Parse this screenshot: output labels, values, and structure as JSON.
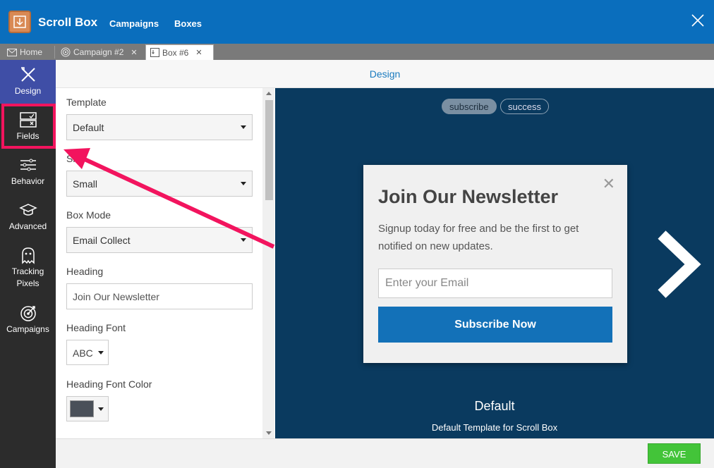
{
  "app": {
    "brand": "Scroll Box",
    "nav": [
      "Campaigns",
      "Boxes"
    ]
  },
  "tabs": [
    {
      "label": "Home",
      "closable": false
    },
    {
      "label": "Campaign #2",
      "closable": true
    },
    {
      "label": "Box #6",
      "closable": true
    }
  ],
  "sidebar": {
    "items": [
      {
        "label": "Design"
      },
      {
        "label": "Fields"
      },
      {
        "label": "Behavior"
      },
      {
        "label": "Advanced"
      },
      {
        "label": "Tracking Pixels"
      },
      {
        "label": "Campaigns"
      }
    ]
  },
  "panel": {
    "title": "Design"
  },
  "form": {
    "template_label": "Template",
    "template_value": "Default",
    "size_label": "Size",
    "size_value": "Small",
    "box_mode_label": "Box Mode",
    "box_mode_value": "Email Collect",
    "heading_label": "Heading",
    "heading_value": "Join Our Newsletter",
    "heading_font_label": "Heading Font",
    "heading_font_value": "ABC",
    "heading_font_color_label": "Heading Font Color",
    "heading_font_color": "#4a5059"
  },
  "preview": {
    "pills": [
      "subscribe",
      "success"
    ],
    "modal": {
      "heading": "Join Our Newsletter",
      "text": "Signup today for free and be the first to get notified on new updates.",
      "email_placeholder": "Enter your Email",
      "button": "Subscribe Now"
    },
    "template_name": "Default",
    "template_desc": "Default Template for Scroll Box"
  },
  "footer": {
    "save": "SAVE"
  },
  "colors": {
    "topbar": "#0a6ebd",
    "highlight": "#f2145e",
    "save": "#43c439",
    "preview_bg": "#0a3a5f"
  }
}
